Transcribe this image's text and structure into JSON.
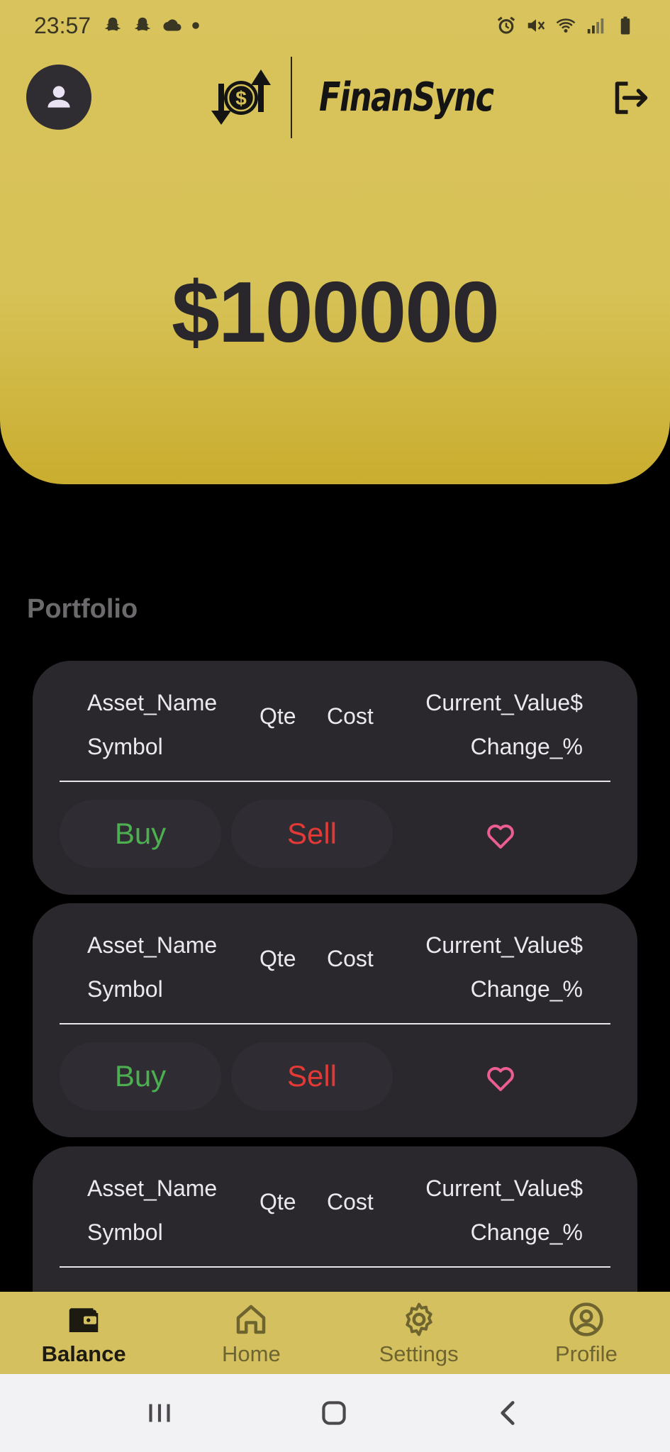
{
  "status_bar": {
    "time": "23:57"
  },
  "header": {
    "app_name": "FinanSync",
    "balance": "$100000",
    "colors": {
      "accent": "#d7c257",
      "dark": "#2a272c"
    }
  },
  "portfolio": {
    "title": "Portfolio",
    "cards": [
      {
        "asset_name": "Asset_Name",
        "symbol": "Symbol",
        "qte": "Qte",
        "cost": "Cost",
        "current_value": "Current_Value$",
        "change": "Change_%",
        "buy_label": "Buy",
        "sell_label": "Sell"
      },
      {
        "asset_name": "Asset_Name",
        "symbol": "Symbol",
        "qte": "Qte",
        "cost": "Cost",
        "current_value": "Current_Value$",
        "change": "Change_%",
        "buy_label": "Buy",
        "sell_label": "Sell"
      },
      {
        "asset_name": "Asset_Name",
        "symbol": "Symbol",
        "qte": "Qte",
        "cost": "Cost",
        "current_value": "Current_Value$",
        "change": "Change_%"
      }
    ]
  },
  "bottom_nav": {
    "items": [
      {
        "label": "Balance",
        "icon": "wallet-icon",
        "active": true
      },
      {
        "label": "Home",
        "icon": "home-icon"
      },
      {
        "label": "Settings",
        "icon": "gear-icon"
      },
      {
        "label": "Profile",
        "icon": "account-circle-icon"
      }
    ]
  }
}
